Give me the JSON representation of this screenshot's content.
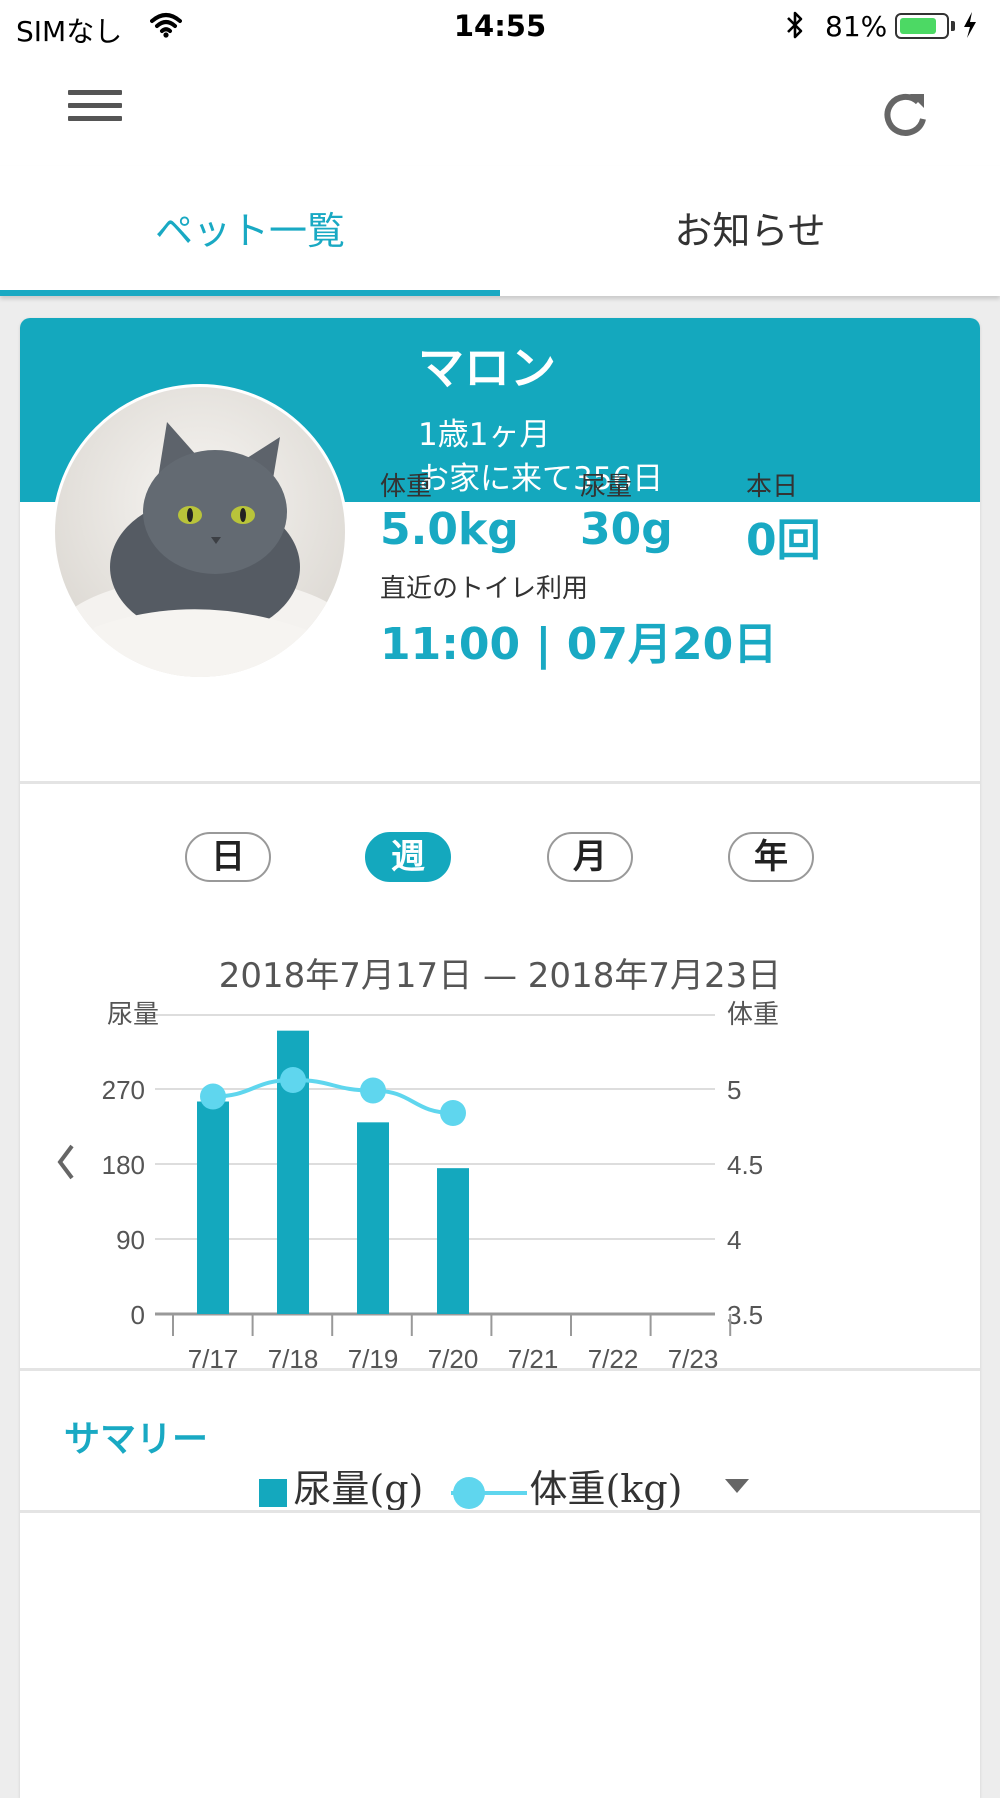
{
  "status_bar": {
    "carrier": "SIMなし",
    "time": "14:55",
    "battery_percent": "81%",
    "battery_level": 0.81
  },
  "app_bar": {
    "menu_icon": "hamburger-menu-icon",
    "refresh_icon": "refresh-icon"
  },
  "tabs": [
    {
      "label": "ペット一覧",
      "active": true
    },
    {
      "label": "お知らせ",
      "active": false
    }
  ],
  "pet": {
    "name": "マロン",
    "age": "1歳1ヶ月",
    "days_at_home": "お家に来て356日",
    "photo_icon": "gray-cat-photo"
  },
  "stats": {
    "weight_label": "体重",
    "weight_value": "5.0kg",
    "urine_label": "尿量",
    "urine_value": "30g",
    "today_label": "本日",
    "today_value": "0回",
    "last_toilet_label": "直近のトイレ利用",
    "last_toilet_value": "11:00 | 07月20日"
  },
  "period_selector": {
    "options": [
      "日",
      "週",
      "月",
      "年"
    ],
    "selected": "週"
  },
  "date_range": "2018年7月17日 — 2018年7月23日",
  "chart_data": {
    "type": "bar",
    "categories": [
      "7/17",
      "7/18",
      "7/19",
      "7/20",
      "7/21",
      "7/22",
      "7/23"
    ],
    "series": [
      {
        "name": "尿量(g)",
        "type": "bar",
        "axis": "left",
        "values": [
          255,
          340,
          230,
          175,
          null,
          null,
          null
        ],
        "color": "#14a8be"
      },
      {
        "name": "体重(kg)",
        "type": "line",
        "axis": "right",
        "values": [
          4.95,
          5.06,
          4.99,
          4.84,
          null,
          null,
          null
        ],
        "color": "#5fd6ee"
      }
    ],
    "ylabel_left": "尿量",
    "ylabel_right": "体重",
    "ylim_left": [
      0,
      360
    ],
    "yticks_left": [
      0,
      90,
      180,
      270
    ],
    "ylim_right": [
      3.5,
      5.4
    ],
    "yticks_right": [
      "3.5",
      "4",
      "4.5",
      "5"
    ],
    "grid": true,
    "legend_placement": "bottom-center"
  },
  "legend": {
    "bar_label": "尿量(g)",
    "line_label": "体重(kg)",
    "dropdown_icon": "caret-down-icon"
  },
  "prev_icon": "chevron-left-icon",
  "summary": {
    "label": "サマリー"
  }
}
